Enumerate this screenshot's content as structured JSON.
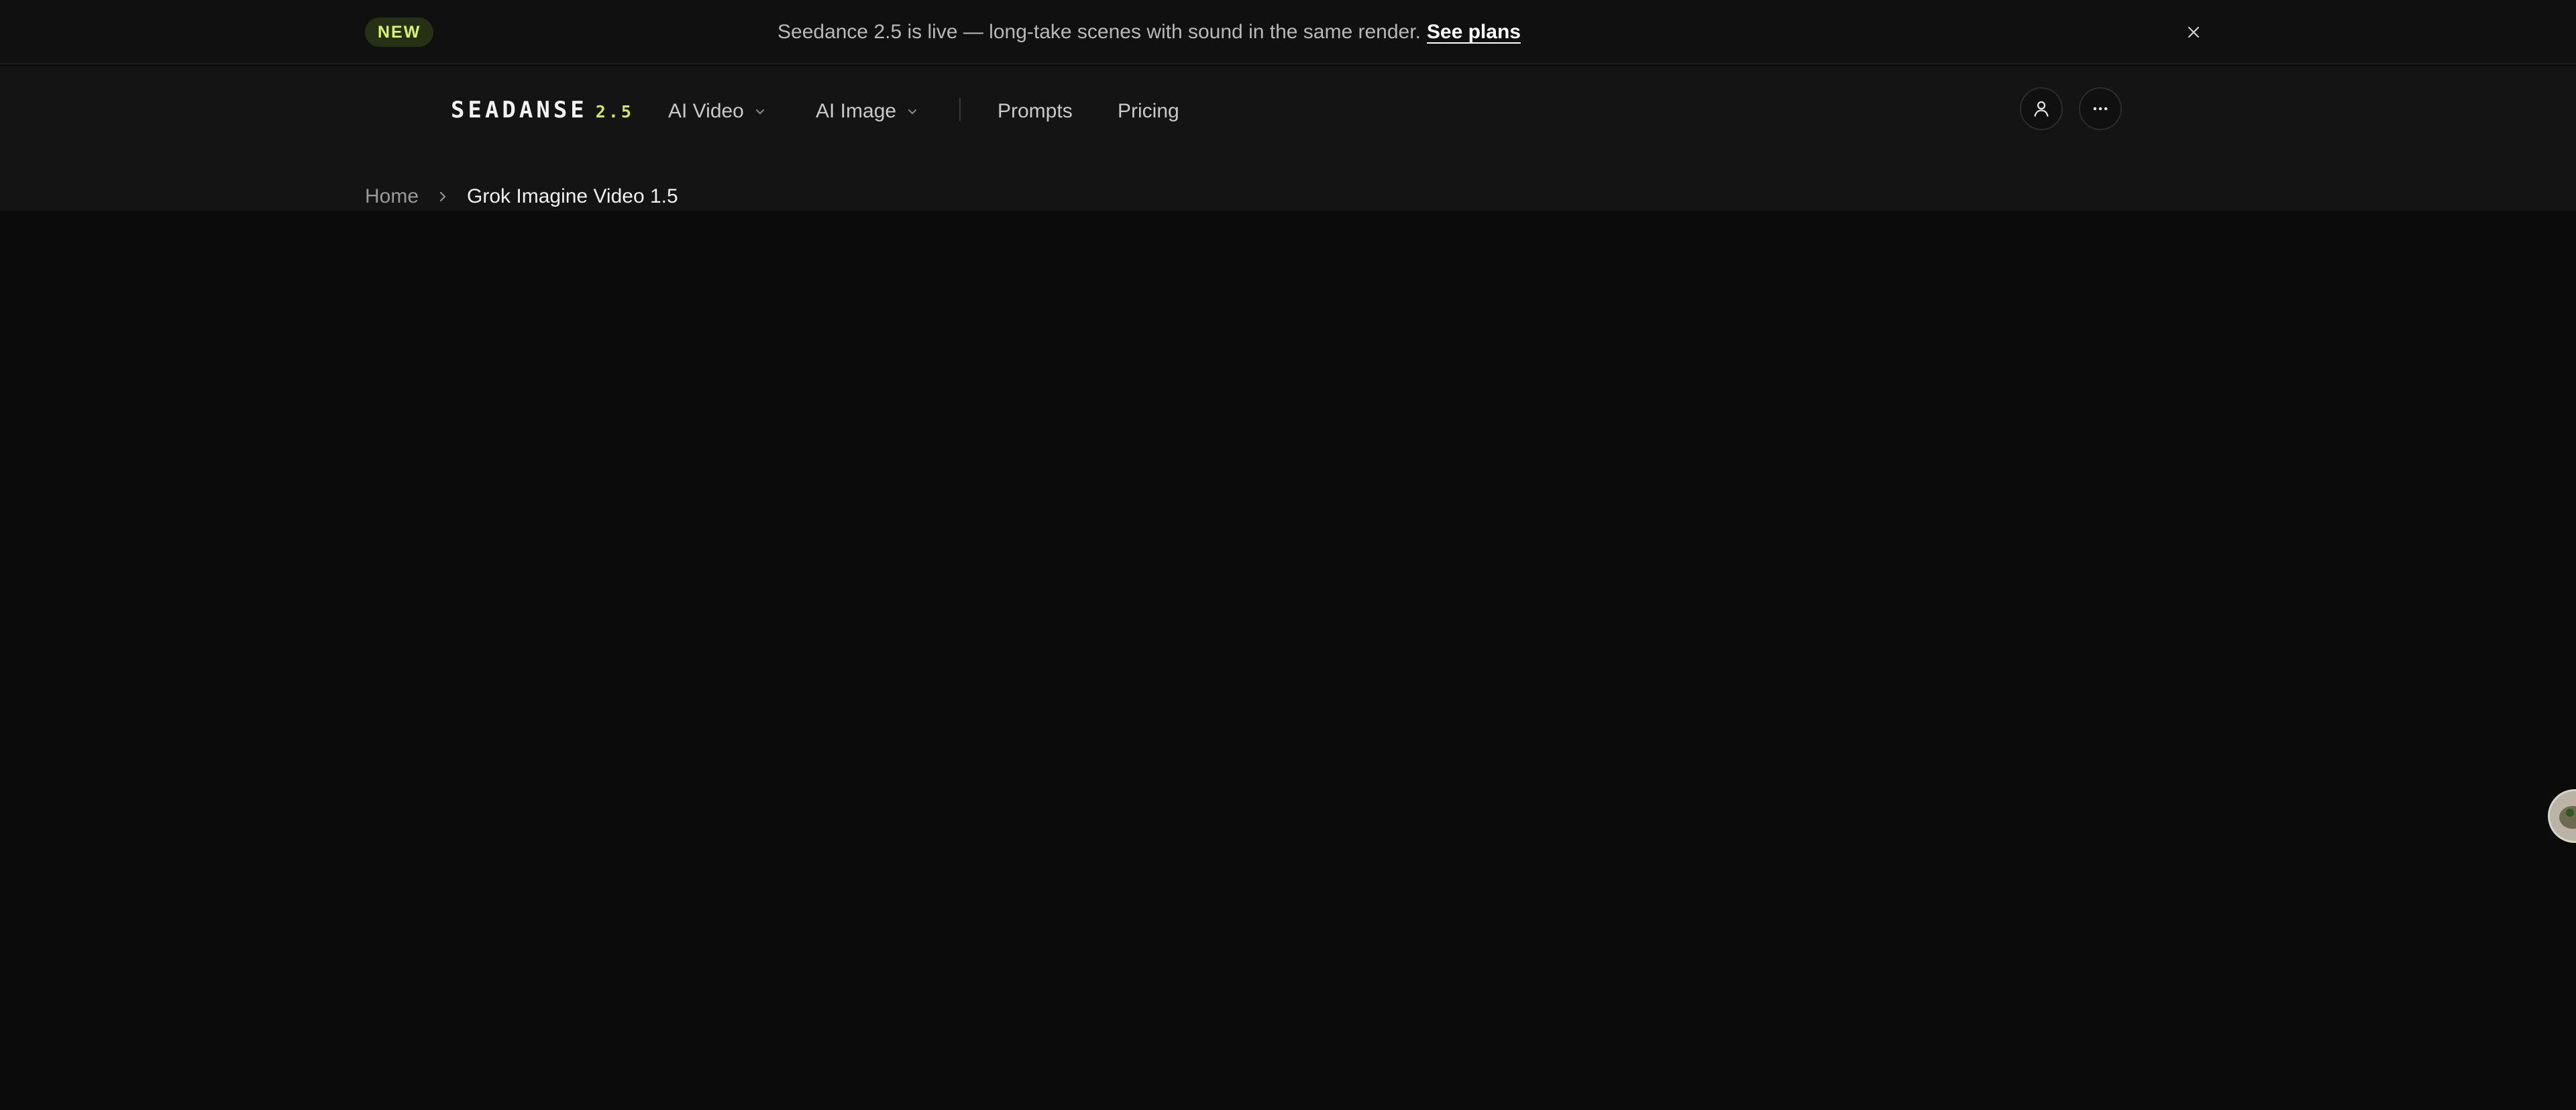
{
  "announcement": {
    "badge": "NEW",
    "message": "Seedance 2.5 is live — long-take scenes with sound in the same render.",
    "cta": "See plans",
    "close_icon": "close-icon"
  },
  "header": {
    "logo": {
      "word": "SEADANSE",
      "version": "2.5"
    },
    "nav": [
      {
        "label": "AI Video",
        "has_dropdown": true
      },
      {
        "label": "AI Image",
        "has_dropdown": true
      },
      {
        "label": "Prompts",
        "has_dropdown": false
      },
      {
        "label": "Pricing",
        "has_dropdown": false
      }
    ],
    "actions": {
      "account_icon": "user-icon",
      "more_icon": "more-dots-icon"
    }
  },
  "breadcrumb": {
    "home": "Home",
    "current": "Grok Imagine Video 1.5"
  },
  "colors": {
    "background": "#0b0b0b",
    "header_bg": "#141414",
    "accent": "#cdea5e",
    "badge_bg": "#253015"
  }
}
